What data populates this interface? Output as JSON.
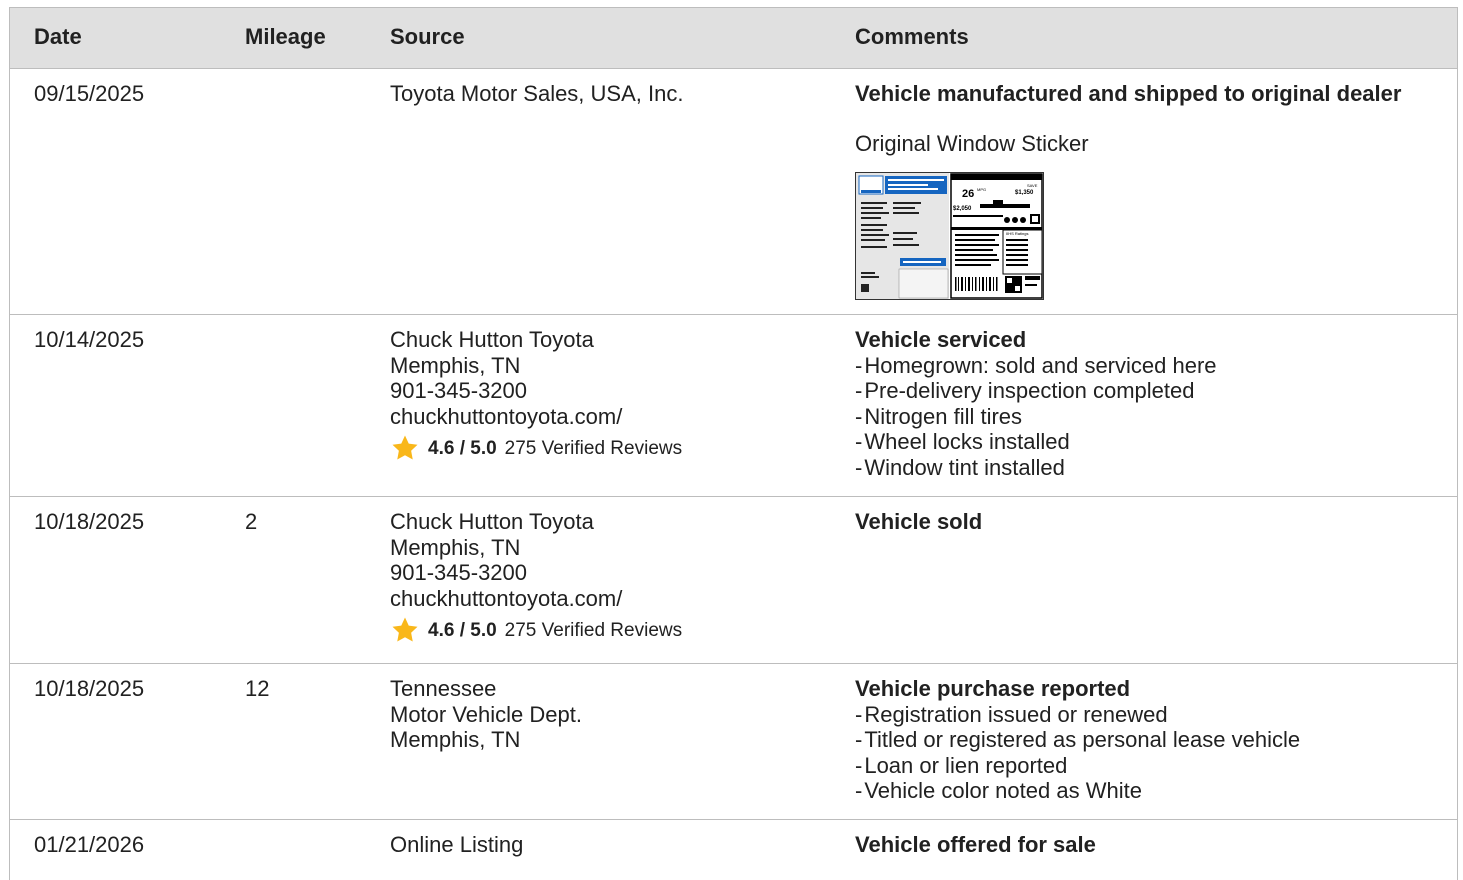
{
  "headers": {
    "date": "Date",
    "mileage": "Mileage",
    "source": "Source",
    "comments": "Comments"
  },
  "rows": [
    {
      "date": "09/15/2025",
      "mileage": "",
      "source": [
        "Toyota Motor Sales, USA, Inc."
      ],
      "rating": null,
      "comment_title": "Vehicle manufactured and shipped to original dealer",
      "comment_sub": "Original Window Sticker",
      "bullets": []
    },
    {
      "date": "10/14/2025",
      "mileage": "",
      "source": [
        "Chuck Hutton Toyota",
        "Memphis, TN",
        "901-345-3200",
        "chuckhuttontoyota.com/"
      ],
      "rating": {
        "score": "4.6 / 5.0",
        "reviews": "275 Verified Reviews"
      },
      "comment_title": "Vehicle serviced",
      "bullets": [
        "Homegrown: sold and serviced here",
        "Pre-delivery inspection completed",
        "Nitrogen fill tires",
        "Wheel locks installed",
        "Window tint installed"
      ]
    },
    {
      "date": "10/18/2025",
      "mileage": "2",
      "source": [
        "Chuck Hutton Toyota",
        "Memphis, TN",
        "901-345-3200",
        "chuckhuttontoyota.com/"
      ],
      "rating": {
        "score": "4.6 / 5.0",
        "reviews": "275 Verified Reviews"
      },
      "comment_title": "Vehicle sold",
      "bullets": []
    },
    {
      "date": "10/18/2025",
      "mileage": "12",
      "source": [
        "Tennessee",
        "Motor Vehicle Dept.",
        "Memphis, TN"
      ],
      "rating": null,
      "comment_title": "Vehicle purchase reported",
      "bullets": [
        "Registration issued or renewed",
        "Titled or registered as personal lease vehicle",
        "Loan or lien reported",
        "Vehicle color noted as White"
      ]
    },
    {
      "date": "01/21/2026",
      "mileage": "",
      "source": [
        "Online Listing"
      ],
      "rating": null,
      "comment_title": "Vehicle offered for sale",
      "bullets": []
    }
  ],
  "sticker": {
    "mpg": "26",
    "mpg_unit": "MPG",
    "save_label": "SAVE",
    "save": "$1,350",
    "fuel_cost": "$2,050",
    "ratings_label": "IIHS Ratings"
  },
  "colors": {
    "star": "#f9b71a",
    "header_bg": "#e0e0e0",
    "border": "#bdbdbd",
    "sticker_blue": "#1565c0"
  }
}
